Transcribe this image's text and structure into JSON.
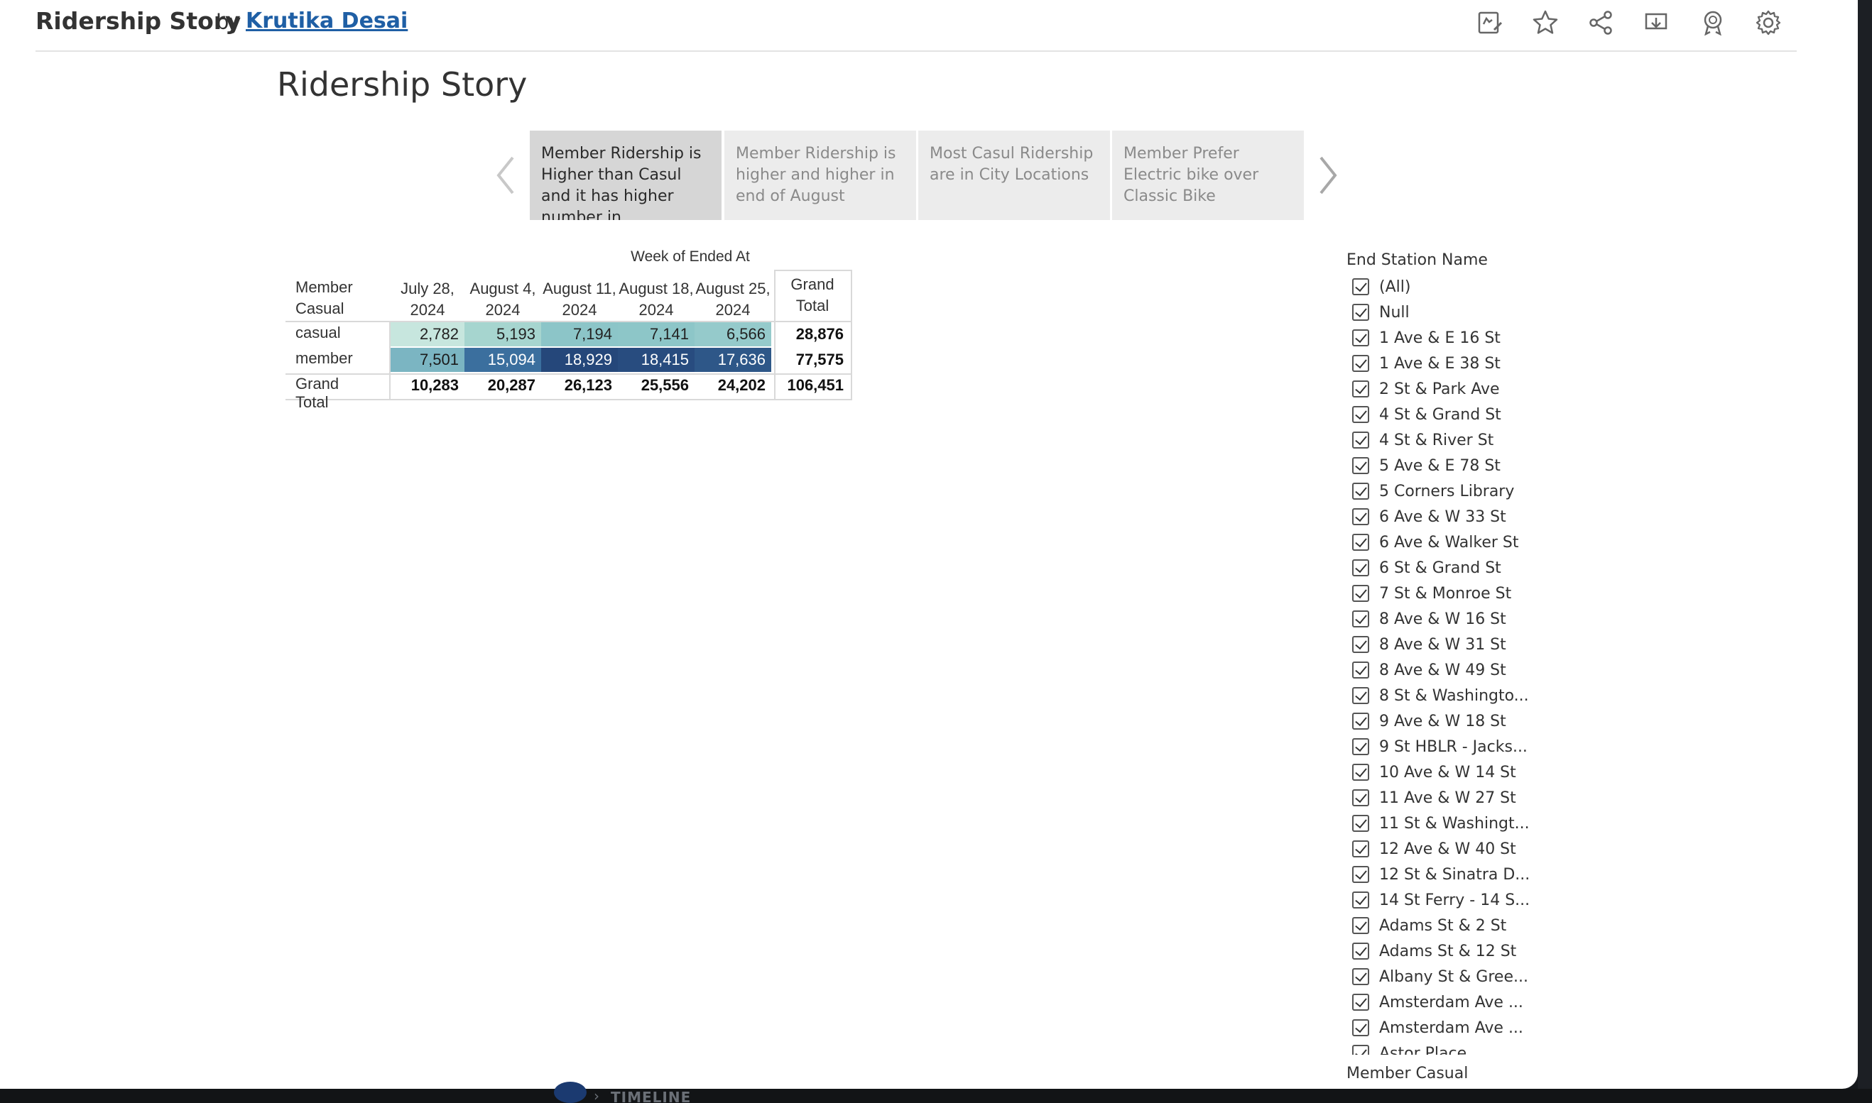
{
  "header": {
    "viz_title": "Ridership Story",
    "by": "by",
    "author": "Krutika Desai",
    "icons": [
      "edit-icon",
      "star-icon",
      "share-icon",
      "download-icon",
      "badge-icon",
      "settings-icon"
    ]
  },
  "story": {
    "title": "Ridership Story",
    "points": [
      {
        "label": "Member Ridership is Higher than Casul and it has higher number in",
        "active": true
      },
      {
        "label": "Member Ridership is higher and higher in end of August",
        "active": false
      },
      {
        "label": "Most Casul Ridership are  in City Locations",
        "active": false
      },
      {
        "label": "Member Prefer Electric bike over Classic Bike",
        "active": false
      }
    ]
  },
  "crosstab": {
    "column_header": "Week of Ended At",
    "row_header": "Member Casual",
    "weeks": [
      "July 28, 2024",
      "August 4, 2024",
      "August 11, 2024",
      "August 18, 2024",
      "August 25, 2024"
    ],
    "grand_total_label": "Grand Total",
    "rows": [
      {
        "label": "casual",
        "values": [
          "2,782",
          "5,193",
          "7,194",
          "7,141",
          "6,566"
        ],
        "total": "28,876",
        "colors": [
          "#c7e6de",
          "#a6d5cf",
          "#8cc5c8",
          "#8dc6c8",
          "#95cacb"
        ]
      },
      {
        "label": "member",
        "values": [
          "7,501",
          "15,094",
          "18,929",
          "18,415",
          "17,636"
        ],
        "total": "77,575",
        "colors": [
          "#7bb5c2",
          "#3b6f9e",
          "#25477a",
          "#284c7f",
          "#2e5788"
        ]
      }
    ],
    "grand_total_row": {
      "label": "Grand Total",
      "values": [
        "10,283",
        "20,287",
        "26,123",
        "25,556",
        "24,202"
      ],
      "total": "106,451"
    }
  },
  "filters": {
    "end_station_title": "End Station Name",
    "end_station_items": [
      "(All)",
      "Null",
      "1 Ave & E 16 St",
      "1 Ave & E 38 St",
      "2 St & Park Ave",
      "4 St & Grand St",
      "4 St & River St",
      "5 Ave & E 78 St",
      "5 Corners Library",
      "6 Ave & W 33 St",
      "6 Ave & Walker St",
      "6 St & Grand St",
      "7 St & Monroe St",
      "8 Ave & W 16 St",
      "8 Ave & W 31 St",
      "8 Ave & W 49 St",
      "8 St & Washingto...",
      "9 Ave & W 18 St",
      "9 St HBLR - Jacks...",
      "10 Ave & W 14 St",
      "11 Ave & W 27 St",
      "11 St & Washingt...",
      "12 Ave & W 40 St",
      "12 St & Sinatra D...",
      "14 St Ferry - 14 S...",
      "Adams St & 2 St",
      "Adams St & 12 St",
      "Albany St & Gree...",
      "Amsterdam Ave ...",
      "Amsterdam Ave ...",
      "Astor Place"
    ],
    "member_casual_title": "Member Casual"
  },
  "background": {
    "timeline_label": "TIMELINE"
  }
}
